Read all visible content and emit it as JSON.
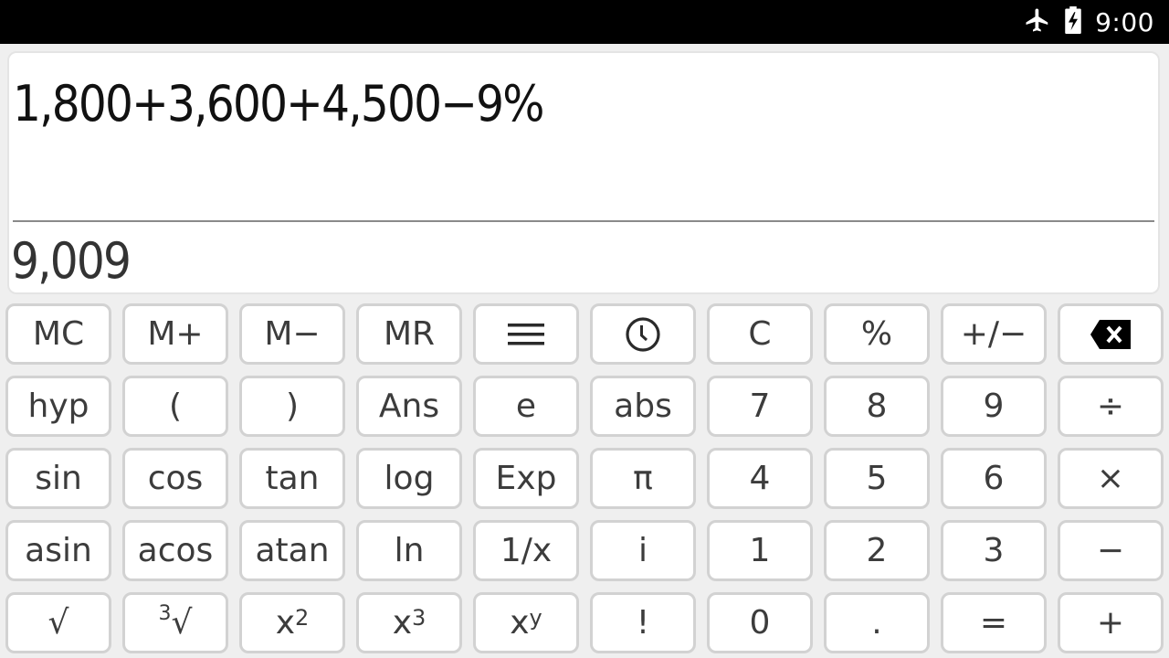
{
  "status_bar": {
    "airplane_mode": true,
    "battery": "charging",
    "time": "9:00"
  },
  "display": {
    "expression": "1,800+3,600+4,500−9%",
    "result": "9,009"
  },
  "keypad": {
    "rows": [
      [
        {
          "id": "mc",
          "label": "MC"
        },
        {
          "id": "m-plus",
          "label": "M+"
        },
        {
          "id": "m-minus",
          "label": "M−"
        },
        {
          "id": "mr",
          "label": "MR"
        },
        {
          "id": "menu",
          "label": "",
          "icon": "menu-icon"
        },
        {
          "id": "history",
          "label": "",
          "icon": "history-icon"
        },
        {
          "id": "clear",
          "label": "C"
        },
        {
          "id": "percent",
          "label": "%"
        },
        {
          "id": "plus-minus",
          "label": "+/−"
        },
        {
          "id": "backspace",
          "label": "",
          "icon": "backspace-icon"
        }
      ],
      [
        {
          "id": "hyp",
          "label": "hyp"
        },
        {
          "id": "open-paren",
          "label": "("
        },
        {
          "id": "close-paren",
          "label": ")"
        },
        {
          "id": "ans",
          "label": "Ans"
        },
        {
          "id": "e",
          "label": "e"
        },
        {
          "id": "abs",
          "label": "abs"
        },
        {
          "id": "7",
          "label": "7"
        },
        {
          "id": "8",
          "label": "8"
        },
        {
          "id": "9",
          "label": "9"
        },
        {
          "id": "divide",
          "label": "÷"
        }
      ],
      [
        {
          "id": "sin",
          "label": "sin"
        },
        {
          "id": "cos",
          "label": "cos"
        },
        {
          "id": "tan",
          "label": "tan"
        },
        {
          "id": "log",
          "label": "log"
        },
        {
          "id": "exp",
          "label": "Exp"
        },
        {
          "id": "pi",
          "label": "π"
        },
        {
          "id": "4",
          "label": "4"
        },
        {
          "id": "5",
          "label": "5"
        },
        {
          "id": "6",
          "label": "6"
        },
        {
          "id": "multiply",
          "label": "×"
        }
      ],
      [
        {
          "id": "asin",
          "label": "asin"
        },
        {
          "id": "acos",
          "label": "acos"
        },
        {
          "id": "atan",
          "label": "atan"
        },
        {
          "id": "ln",
          "label": "ln"
        },
        {
          "id": "reciprocal",
          "label": "1/x"
        },
        {
          "id": "imaginary",
          "label": "i"
        },
        {
          "id": "1",
          "label": "1"
        },
        {
          "id": "2",
          "label": "2"
        },
        {
          "id": "3",
          "label": "3"
        },
        {
          "id": "subtract",
          "label": "−"
        }
      ],
      [
        {
          "id": "sqrt",
          "label": "√"
        },
        {
          "id": "cbrt",
          "label": "√",
          "pre": "3"
        },
        {
          "id": "square",
          "label": "x",
          "sup": "2"
        },
        {
          "id": "cube",
          "label": "x",
          "sup": "3"
        },
        {
          "id": "power",
          "label": "x",
          "sup": "y"
        },
        {
          "id": "factorial",
          "label": "!"
        },
        {
          "id": "0",
          "label": "0"
        },
        {
          "id": "decimal",
          "label": "."
        },
        {
          "id": "equals",
          "label": "="
        },
        {
          "id": "add",
          "label": "+"
        }
      ]
    ]
  }
}
